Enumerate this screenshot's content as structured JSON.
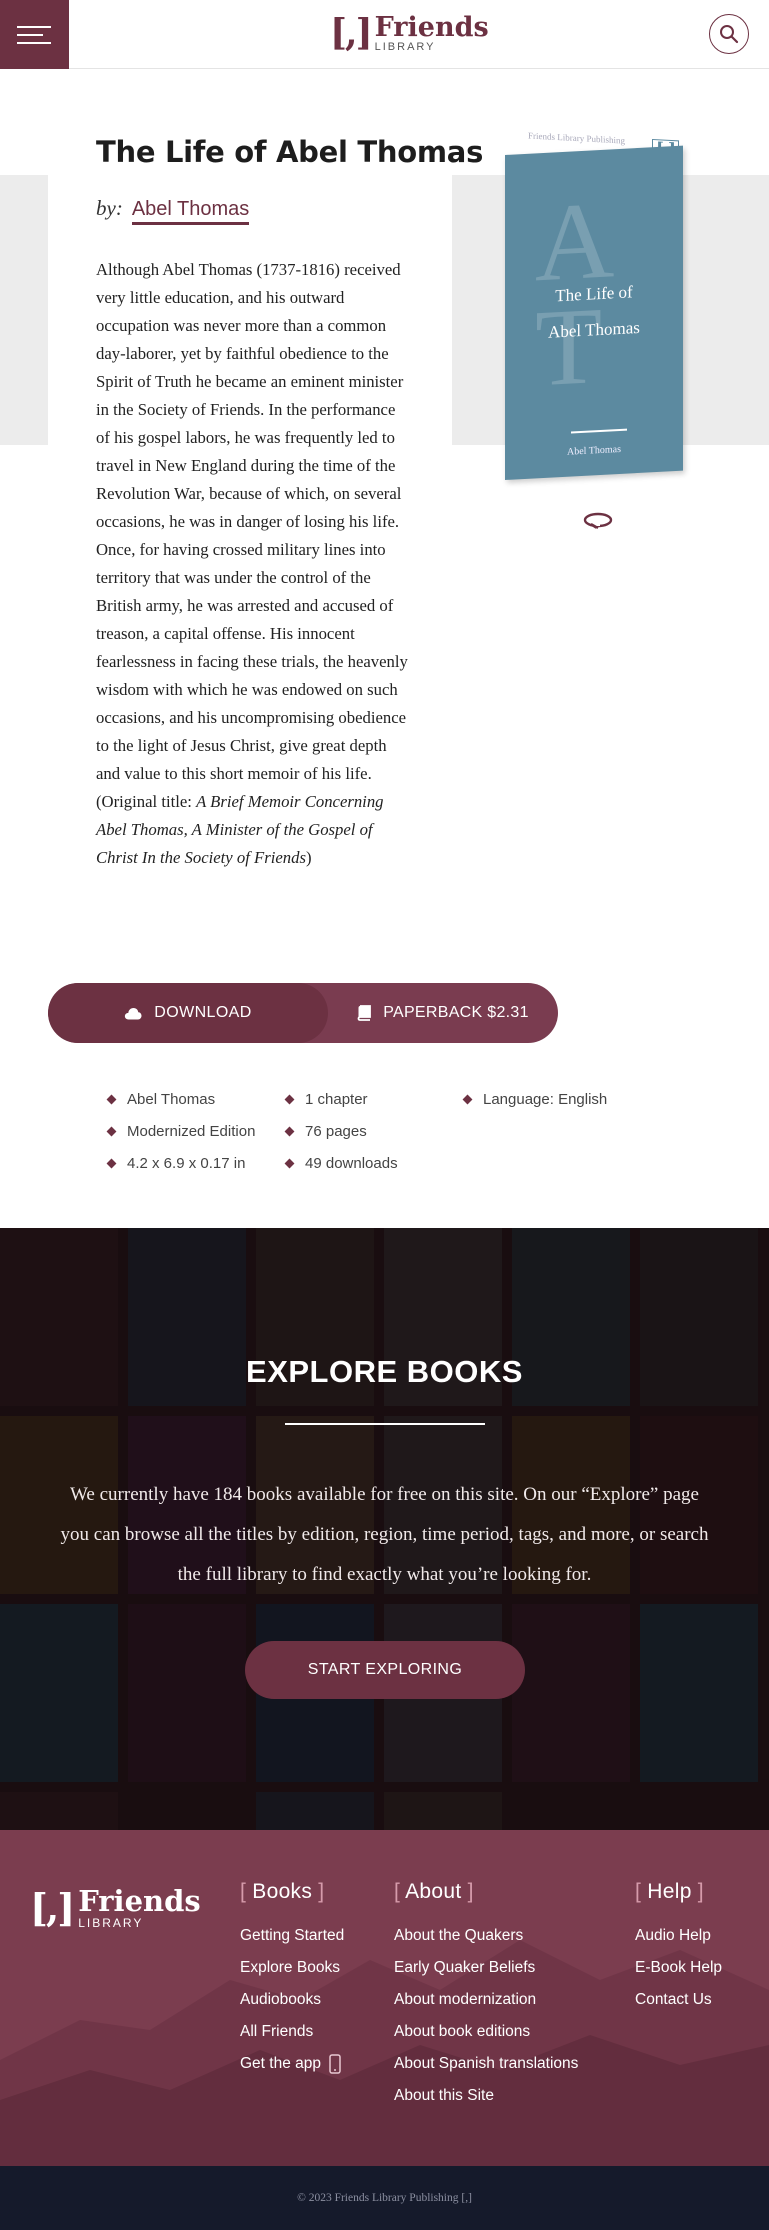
{
  "header": {
    "logo_bracket": "[,]",
    "logo_name": "Friends",
    "logo_sub": "LIBRARY"
  },
  "book": {
    "title": "The Life of Abel Thomas",
    "by_label": "by:",
    "author": "Abel Thomas",
    "description": "Although Abel Thomas (1737-1816) received very little education, and his outward occupation was never more than a common day-laborer, yet by faithful obedience to the Spirit of Truth he became an eminent minister in the Society of Friends. In the performance of his gospel labors, he was frequently led to travel in New England during the time of the Revolution War, because of which, on several occasions, he was in danger of losing his life. Once, for having crossed military lines into territory that was under the control of the British army, he was arrested and accused of treason, a capital offense. His innocent fearlessness in facing these trials, the heavenly wisdom with which he was endowed on such occasions, and his uncompromising obedience to the light of Jesus Christ, give great depth and value to this short memoir of his life.",
    "original_prefix": "(Original title: ",
    "original_title": "A Brief Memoir Concerning Abel Thomas, A Minister of the Gospel of Christ In the Society of Friends",
    "original_suffix": ")"
  },
  "cover": {
    "publisher": "Friends Library Publishing",
    "icon": "[,]",
    "letter1": "A",
    "letter2": "T",
    "title_line1": "The Life of",
    "title_line2": "Abel Thomas",
    "author": "Abel Thomas",
    "color": "#5c8aa0"
  },
  "actions": {
    "download_label": "DOWNLOAD",
    "paperback_label": "PAPERBACK $2.31"
  },
  "meta": [
    "Abel Thomas",
    "1 chapter",
    "Language: English",
    "Modernized Edition",
    "76 pages",
    "",
    "4.2 x 6.9 x 0.17 in",
    "49 downloads",
    ""
  ],
  "explore": {
    "title": "EXPLORE BOOKS",
    "text": "We currently have 184 books available for free on this site. On our “Explore” page you can browse all the titles by edition, region, time period, tags, and more, or search the full library to find exactly what you’re looking for.",
    "button": "START EXPLORING"
  },
  "footer": {
    "logo_bracket": "[,]",
    "logo_name": "Friends",
    "logo_sub": "LIBRARY",
    "columns": [
      {
        "heading": "Books",
        "links": [
          "Getting Started",
          "Explore Books",
          "Audiobooks",
          "All Friends",
          "Get the app"
        ]
      },
      {
        "heading": "About",
        "links": [
          "About the Quakers",
          "Early Quaker Beliefs",
          "About modernization",
          "About book editions",
          "About Spanish translations",
          "About this Site"
        ]
      },
      {
        "heading": "Help",
        "links": [
          "Audio Help",
          "E-Book Help",
          "Contact Us"
        ]
      }
    ],
    "copyright": "© 2023 Friends Library Publishing [,]"
  },
  "colors": {
    "brand": "#6c3142",
    "footer": "#7b3d4f",
    "copyright_bar": "#151a2b"
  }
}
